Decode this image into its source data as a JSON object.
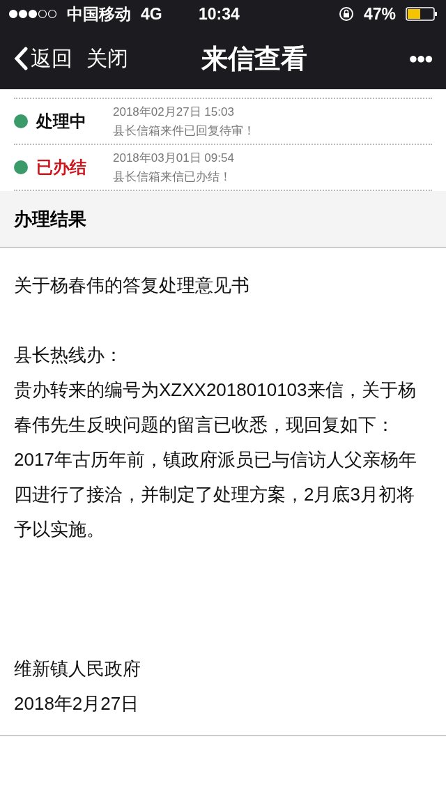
{
  "status_bar": {
    "carrier": "中国移动",
    "network": "4G",
    "time": "10:34",
    "battery": "47%"
  },
  "nav": {
    "back": "返回",
    "close": "关闭",
    "title": "来信查看",
    "more": "●●●"
  },
  "timeline": [
    {
      "status": "处理中",
      "kind": "pending",
      "color": "#3a9a6a",
      "time": "2018年02月27日 15:03",
      "note": "县长信箱来件已回复待审！"
    },
    {
      "status": "已办结",
      "kind": "done",
      "color": "#3a9a6a",
      "time": "2018年03月01日 09:54",
      "note": "县长信箱来信已办结！"
    }
  ],
  "result": {
    "heading": "办理结果",
    "title": "关于杨春伟的答复处理意见书",
    "salutation": "县长热线办：",
    "paragraphs": [
      "贵办转来的编号为XZXX2018010103来信，关于杨春伟先生反映问题的留言已收悉，现回复如下：",
      "2017年古历年前，镇政府派员已与信访人父亲杨年四进行了接洽，并制定了处理方案，2月底3月初将予以实施。"
    ],
    "signature": "维新镇人民政府",
    "date": "2018年2月27日"
  }
}
